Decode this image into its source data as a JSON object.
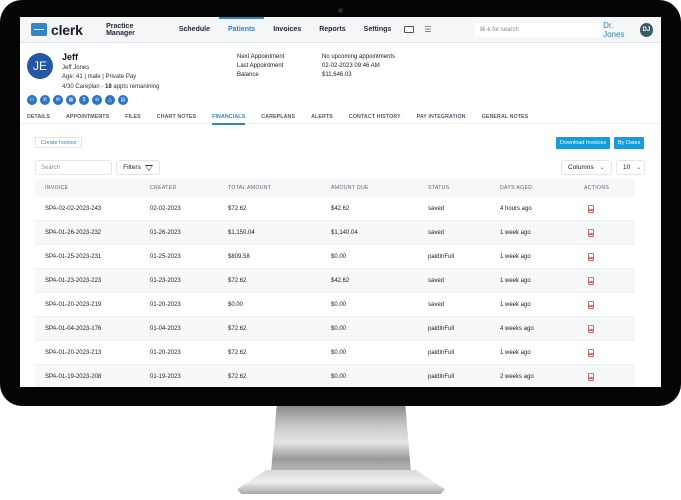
{
  "app": {
    "logo_text": "clerk",
    "nav": [
      "Practice Manager",
      "Schedule",
      "Patients",
      "Invoices",
      "Reports",
      "Settings"
    ],
    "active_nav": "Patients",
    "search_placeholder": "⌘-k for search",
    "user_name": "Dr. Jones",
    "user_initials": "DJ",
    "accent_color": "#2f86c9"
  },
  "patient": {
    "initials": "JE",
    "first_name": "Jeff",
    "full_name": "Jeff Jones",
    "demographics": "Age: 41 | male | Private Pay",
    "careplan_prefix": "4/30 Careplan - ",
    "careplan_count": "18",
    "careplan_suffix": " appts remanining",
    "action_icons": [
      "chat",
      "phone",
      "email",
      "calendar",
      "dollar",
      "attach",
      "alert",
      "document"
    ],
    "info": [
      {
        "label": "Next Appointment",
        "value": "No upcoming appointments"
      },
      {
        "label": "Last Appointment",
        "value": "02-02-2023 09:46 AM"
      },
      {
        "label": "Balance",
        "value": "$11,646.03"
      }
    ]
  },
  "tabs": [
    "DETAILS",
    "APPOINTMENTS",
    "FILES",
    "CHART NOTES",
    "FINANCIALS",
    "CAREPLANS",
    "ALERTS",
    "CONTACT HISTORY",
    "PAY INTEGRATION",
    "GENERAL NOTES"
  ],
  "active_tab": "FINANCIALS",
  "toolbar": {
    "create_invoice": "Create Invoice",
    "download_invoices": "Download Invoices",
    "by_dates": "By Dates",
    "search_placeholder": "Search",
    "filters": "Filters",
    "columns": "Columns",
    "page_size": "10"
  },
  "table": {
    "headers": [
      "INVOICE",
      "CREATED",
      "TOTAL AMOUNT",
      "AMOUNT DUE",
      "STATUS",
      "DAYS AGED",
      "ACTIONS"
    ],
    "rows": [
      {
        "invoice": "SPA-02-02-2023-243",
        "created": "02-02-2023",
        "total": "$72.62",
        "due": "$42.62",
        "status": "saved",
        "aged": "4 hours ago"
      },
      {
        "invoice": "SPA-01-26-2023-232",
        "created": "01-26-2023",
        "total": "$1,150.04",
        "due": "$1,140.04",
        "status": "saved",
        "aged": "1 week ago"
      },
      {
        "invoice": "SPA-01-25-2023-231",
        "created": "01-25-2023",
        "total": "$809.58",
        "due": "$0.00",
        "status": "paidInFull",
        "aged": "1 week ago"
      },
      {
        "invoice": "SPA-01-23-2023-223",
        "created": "01-23-2023",
        "total": "$72.62",
        "due": "$42.62",
        "status": "saved",
        "aged": "1 week ago"
      },
      {
        "invoice": "SPA-01-20-2023-219",
        "created": "01-20-2023",
        "total": "$0.00",
        "due": "$0.00",
        "status": "saved",
        "aged": "1 week ago"
      },
      {
        "invoice": "SPA-01-04-2023-176",
        "created": "01-04-2023",
        "total": "$72.62",
        "due": "$0.00",
        "status": "paidInFull",
        "aged": "4 weeks ago"
      },
      {
        "invoice": "SPA-01-20-2023-213",
        "created": "01-20-2023",
        "total": "$72.62",
        "due": "$0.00",
        "status": "paidInFull",
        "aged": "1 week ago"
      },
      {
        "invoice": "SPA-01-19-2023-208",
        "created": "01-19-2023",
        "total": "$72.62",
        "due": "$0.00",
        "status": "paidInFull",
        "aged": "2 weeks ago"
      }
    ]
  }
}
